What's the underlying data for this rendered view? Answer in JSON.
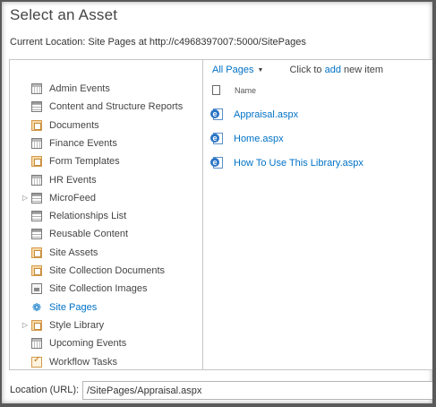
{
  "dialog": {
    "title": "Select an Asset",
    "current_location": "Current Location: Site Pages at http://c4968397007:5000/SitePages"
  },
  "tree": {
    "items": [
      {
        "label": "Admin Events",
        "icon": "calendar-icon",
        "expandable": false,
        "selected": false
      },
      {
        "label": "Content and Structure Reports",
        "icon": "list-icon",
        "expandable": false,
        "selected": false
      },
      {
        "label": "Documents",
        "icon": "library-icon",
        "expandable": false,
        "selected": false
      },
      {
        "label": "Finance Events",
        "icon": "calendar-icon",
        "expandable": false,
        "selected": false
      },
      {
        "label": "Form Templates",
        "icon": "library-icon",
        "expandable": false,
        "selected": false
      },
      {
        "label": "HR Events",
        "icon": "calendar-icon",
        "expandable": false,
        "selected": false
      },
      {
        "label": "MicroFeed",
        "icon": "list-icon",
        "expandable": true,
        "selected": false
      },
      {
        "label": "Relationships List",
        "icon": "list-icon",
        "expandable": false,
        "selected": false
      },
      {
        "label": "Reusable Content",
        "icon": "list-icon",
        "expandable": false,
        "selected": false
      },
      {
        "label": "Site Assets",
        "icon": "library-icon",
        "expandable": false,
        "selected": false
      },
      {
        "label": "Site Collection Documents",
        "icon": "library-icon",
        "expandable": false,
        "selected": false
      },
      {
        "label": "Site Collection Images",
        "icon": "image-library-icon",
        "expandable": false,
        "selected": false
      },
      {
        "label": "Site Pages",
        "icon": "site-pages-icon",
        "expandable": false,
        "selected": true
      },
      {
        "label": "Style Library",
        "icon": "library-icon",
        "expandable": true,
        "selected": false
      },
      {
        "label": "Upcoming Events",
        "icon": "calendar-icon",
        "expandable": false,
        "selected": false
      },
      {
        "label": "Workflow Tasks",
        "icon": "tasks-icon",
        "expandable": false,
        "selected": false
      }
    ]
  },
  "files_pane": {
    "view_label": "All Pages",
    "click_to": "Click to",
    "add_link": "add",
    "new_item_text": "new item",
    "column_name": "Name",
    "files": [
      {
        "name": "Appraisal.aspx"
      },
      {
        "name": "Home.aspx"
      },
      {
        "name": "How To Use This Library.aspx"
      }
    ]
  },
  "location": {
    "label": "Location (URL):",
    "value": "/SitePages/Appraisal.aspx"
  },
  "colors": {
    "link": "#0072c6",
    "border": "#c6c6c6"
  }
}
